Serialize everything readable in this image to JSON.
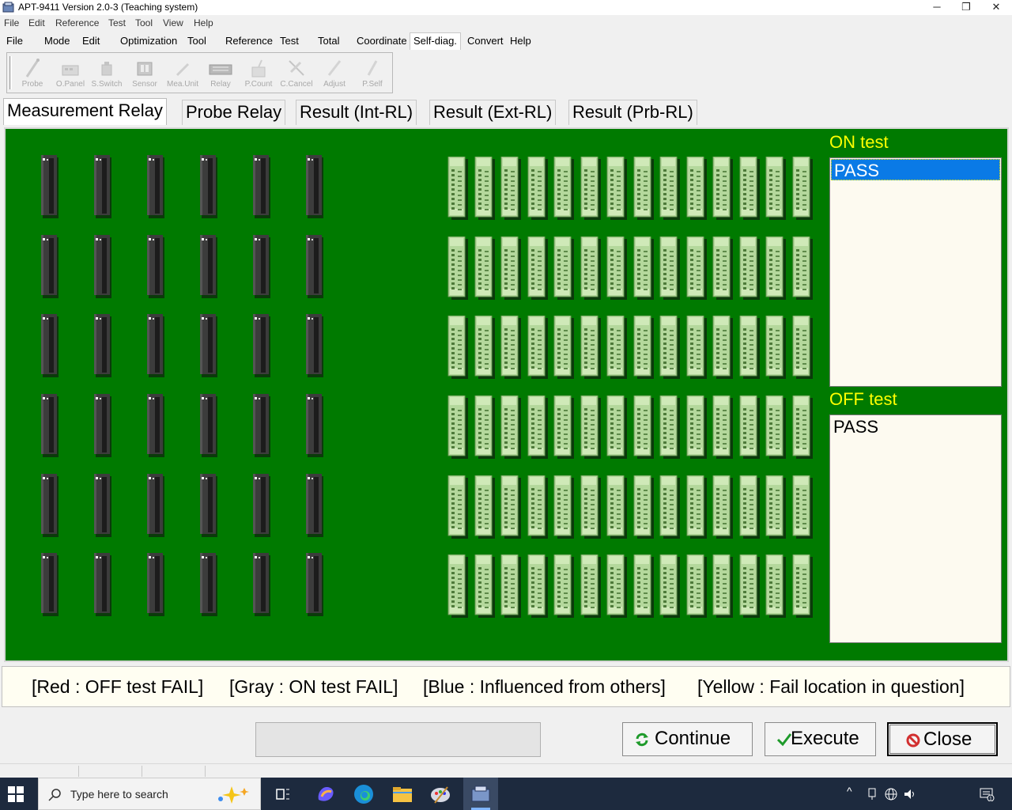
{
  "window": {
    "title": "APT-9411 Version 2.0-3 (Teaching system)",
    "minimize": "─",
    "restore": "❐",
    "close": "✕"
  },
  "menu1": [
    "File",
    "Edit",
    "Reference",
    "Test",
    "Tool",
    "View",
    "Help"
  ],
  "menu2": [
    "File",
    "Mode",
    "Edit",
    "Optimization",
    "Tool",
    "Reference",
    "Test",
    "Total",
    "Coordinate",
    "Self-diag.",
    "Convert",
    "Help"
  ],
  "menu2_active": "Self-diag.",
  "toolbar": [
    "Probe",
    "O.Panel",
    "S.Switch",
    "Sensor",
    "Mea.Unit",
    "Relay",
    "P.Count",
    "C.Cancel",
    "Adjust",
    "P.Self"
  ],
  "tabs": [
    "Measurement Relay",
    "Probe Relay",
    "Result (Int-RL)",
    "Result (Ext-RL)",
    "Result (Prb-RL)"
  ],
  "active_tab": "Measurement Relay",
  "board": {
    "background_color": "#007a00",
    "dark_relay_rows": 6,
    "dark_relay_cols": 6,
    "green_relay_rows": 6,
    "green_relay_cols": 14
  },
  "on_test": {
    "label": "ON  test",
    "items": [
      "PASS"
    ],
    "selected": 0
  },
  "off_test": {
    "label": "OFF  test",
    "items": [
      "PASS"
    ]
  },
  "legend": [
    "[Red : OFF test FAIL]",
    "[Gray : ON test FAIL]",
    "[Blue : Influenced from others]",
    "[Yellow : Fail location in question]"
  ],
  "buttons": {
    "continue": "Continue",
    "execute": "Execute",
    "close": "Close"
  },
  "taskbar": {
    "search_placeholder": "Type here to search"
  },
  "colors": {
    "board": "#007a00",
    "test_label": "#ffff00",
    "selection": "#0a7ae6"
  }
}
